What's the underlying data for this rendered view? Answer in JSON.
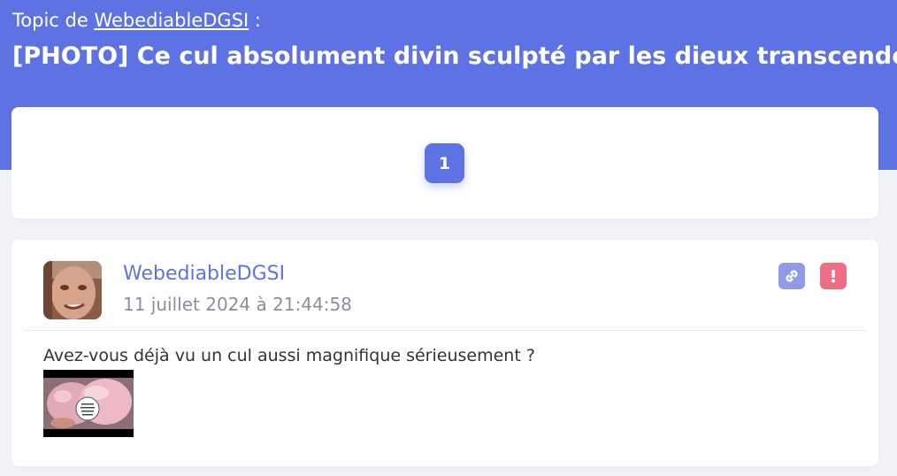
{
  "header": {
    "topic_prefix": "Topic de",
    "topic_author": "WebediableDGSI",
    "topic_suffix": " :",
    "title": "[PHOTO] Ce cul absolument divin sculpté par les dieux transcende les"
  },
  "pagination": {
    "pages": [
      "1"
    ],
    "current": "1"
  },
  "post": {
    "author": "WebediableDGSI",
    "date": "11 juillet 2024 à 21:44:58",
    "message": "Avez-vous déjà vu un cul aussi magnifique sérieusement ?",
    "actions": {
      "link_icon": "link-icon",
      "report_icon": "exclamation-icon"
    }
  },
  "colors": {
    "brand": "#5e73e3",
    "link_button": "#8d9be8",
    "report_button": "#f06d86",
    "muted_text": "#8a8f98"
  }
}
